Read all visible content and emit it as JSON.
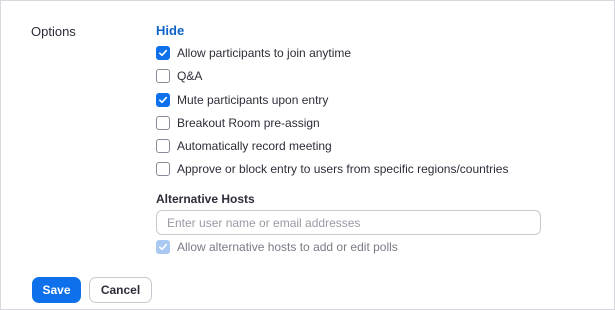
{
  "options": {
    "label": "Options",
    "hide_link": "Hide",
    "items": [
      {
        "label": "Allow participants to join anytime",
        "checked": true
      },
      {
        "label": "Q&A",
        "checked": false
      },
      {
        "label": "Mute participants upon entry",
        "checked": true
      },
      {
        "label": "Breakout Room pre-assign",
        "checked": false
      },
      {
        "label": "Automatically record meeting",
        "checked": false
      },
      {
        "label": "Approve or block entry to users from specific regions/countries",
        "checked": false
      }
    ]
  },
  "alternative_hosts": {
    "title": "Alternative Hosts",
    "placeholder": "Enter user name or email addresses",
    "value": "",
    "poll_option": {
      "label": "Allow alternative hosts to add or edit polls",
      "checked": true,
      "disabled": true
    }
  },
  "actions": {
    "save_label": "Save",
    "cancel_label": "Cancel"
  },
  "colors": {
    "accent": "#0e71eb",
    "link": "#0e63c9",
    "disabled_check": "#a9c9f3"
  }
}
